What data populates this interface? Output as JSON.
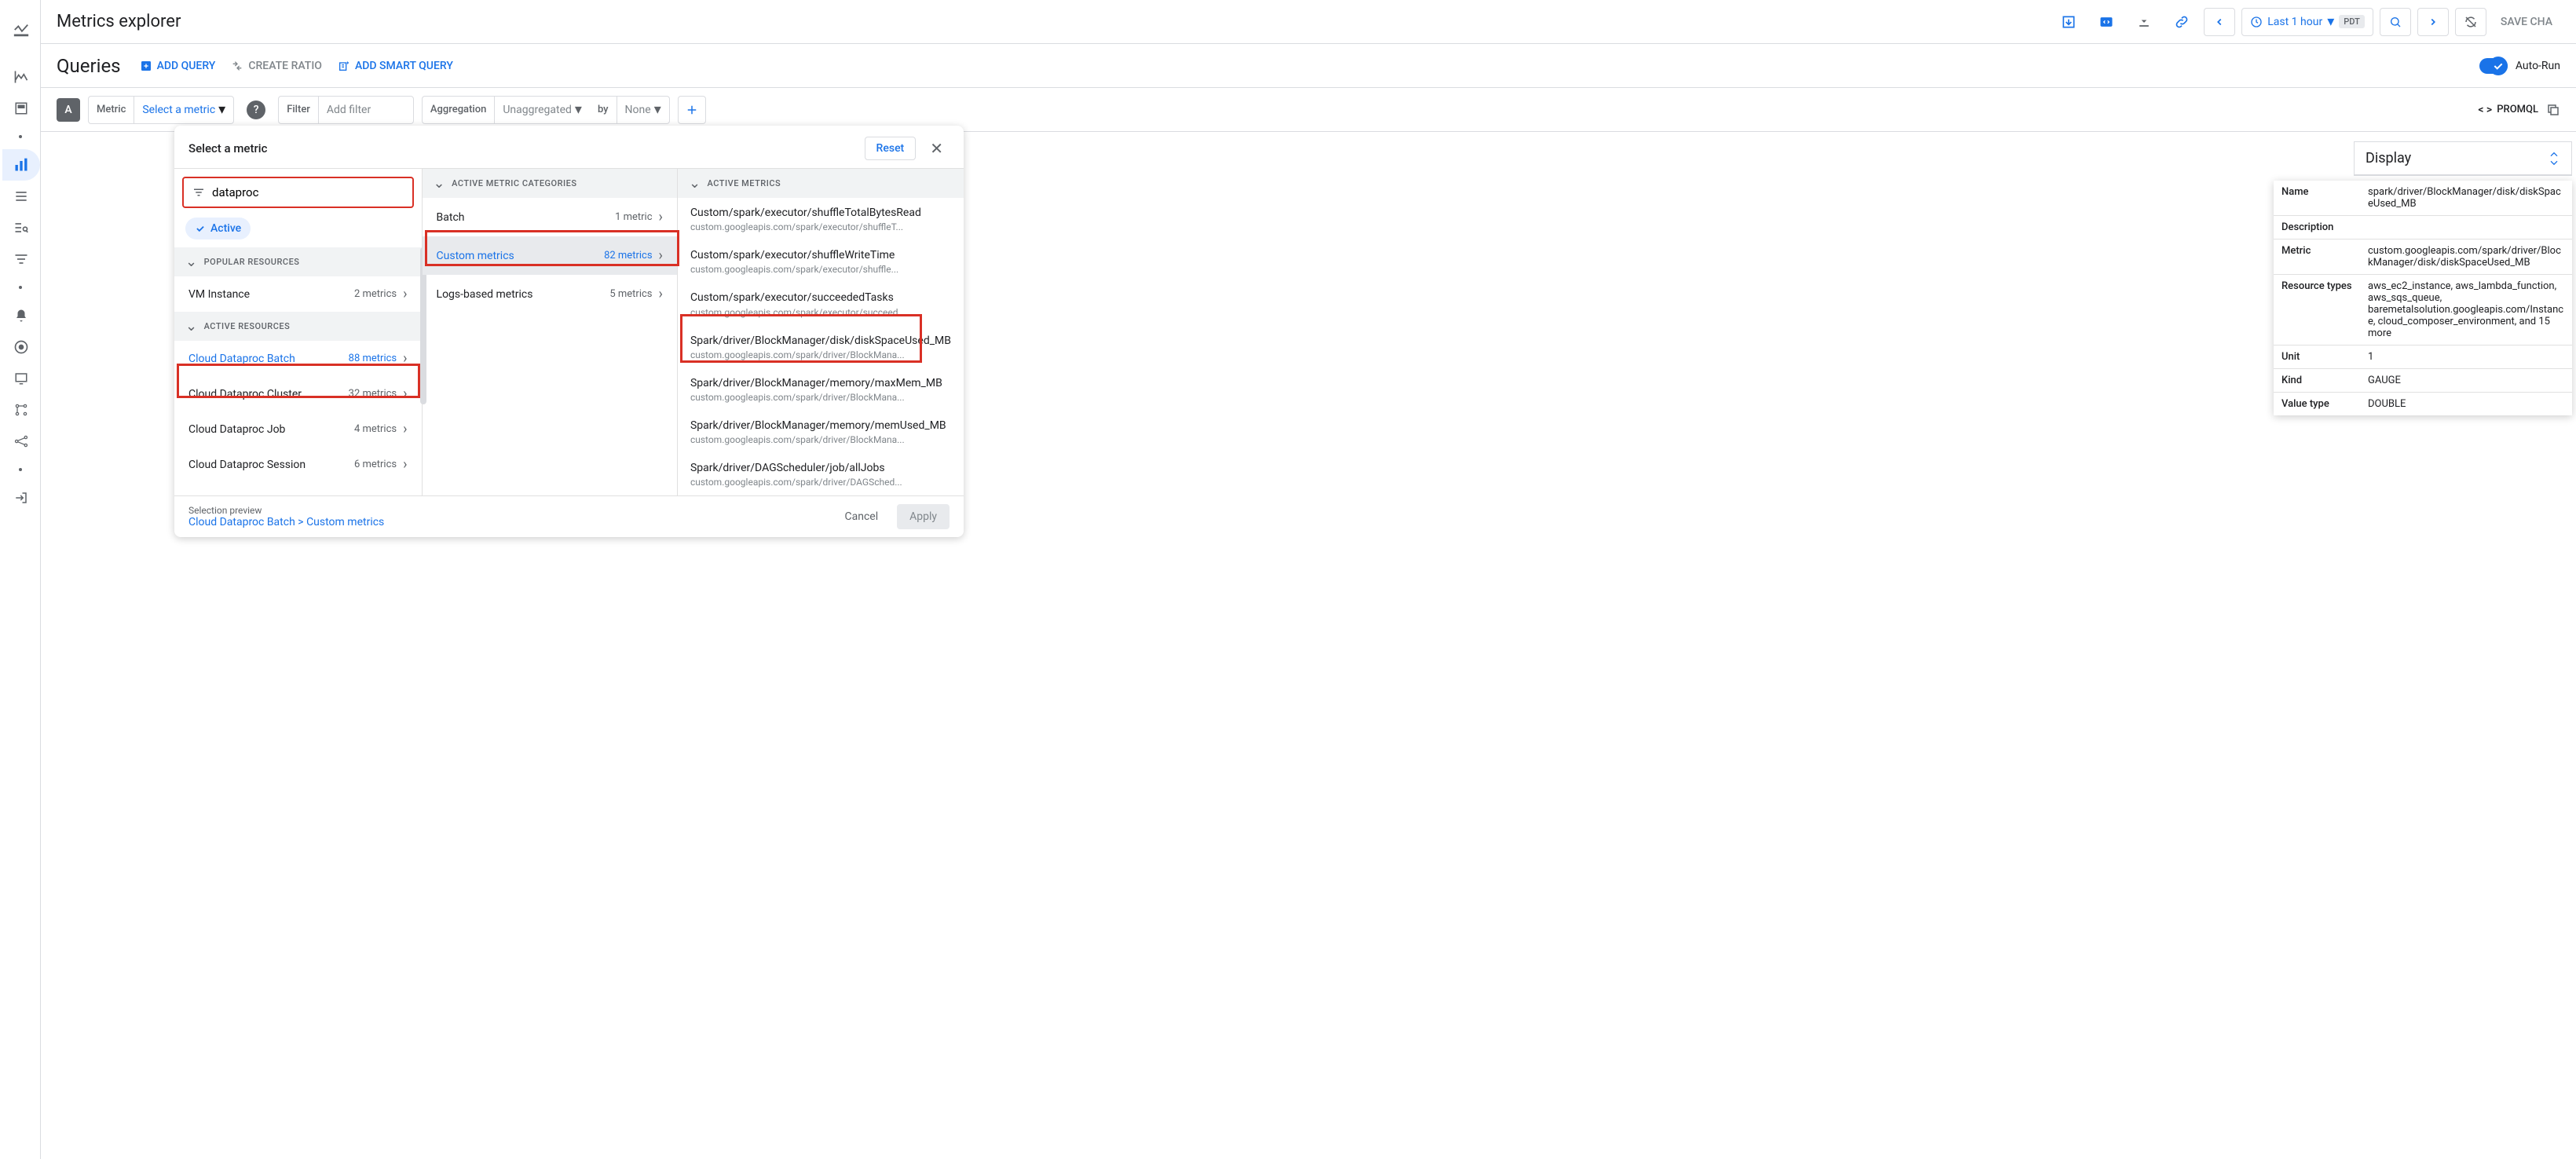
{
  "header": {
    "page_title": "Metrics explorer",
    "time_range": "Last 1 hour",
    "timezone": "PDT",
    "save_chart": "SAVE CHA"
  },
  "queries": {
    "title": "Queries",
    "add_query": "ADD QUERY",
    "create_ratio": "CREATE RATIO",
    "add_smart_query": "ADD SMART QUERY",
    "auto_run": "Auto-Run"
  },
  "builder": {
    "query_id": "A",
    "metric_label": "Metric",
    "metric_value": "Select a metric",
    "filter_label": "Filter",
    "filter_placeholder": "Add filter",
    "aggregation_label": "Aggregation",
    "aggregation_value": "Unaggregated",
    "by_label": "by",
    "by_value": "None",
    "promql": "PROMQL"
  },
  "dropdown": {
    "title": "Select a metric",
    "reset": "Reset",
    "search_value": "dataproc",
    "active_chip": "Active",
    "col1_header1": "POPULAR RESOURCES",
    "col1_header2": "ACTIVE RESOURCES",
    "resources": {
      "vm": {
        "name": "VM Instance",
        "count": "2 metrics"
      },
      "batch": {
        "name": "Cloud Dataproc Batch",
        "count": "88 metrics"
      },
      "cluster": {
        "name": "Cloud Dataproc Cluster",
        "count": "32 metrics"
      },
      "job": {
        "name": "Cloud Dataproc Job",
        "count": "4 metrics"
      },
      "session": {
        "name": "Cloud Dataproc Session",
        "count": "6 metrics"
      }
    },
    "col2_header": "ACTIVE METRIC CATEGORIES",
    "categories": {
      "batch": {
        "name": "Batch",
        "count": "1 metric"
      },
      "custom": {
        "name": "Custom metrics",
        "count": "82 metrics"
      },
      "logs": {
        "name": "Logs-based metrics",
        "count": "5 metrics"
      }
    },
    "col3_header": "ACTIVE METRICS",
    "metrics": [
      {
        "name": "Custom/spark/executor/shuffleTotalBytesRead",
        "path": "custom.googleapis.com/spark/executor/shuffleT..."
      },
      {
        "name": "Custom/spark/executor/shuffleWriteTime",
        "path": "custom.googleapis.com/spark/executor/shuffle..."
      },
      {
        "name": "Custom/spark/executor/succeededTasks",
        "path": "custom.googleapis.com/spark/executor/succeed..."
      },
      {
        "name": "Spark/driver/BlockManager/disk/diskSpaceUsed_MB",
        "path": "custom.googleapis.com/spark/driver/BlockMana..."
      },
      {
        "name": "Spark/driver/BlockManager/memory/maxMem_MB",
        "path": "custom.googleapis.com/spark/driver/BlockMana..."
      },
      {
        "name": "Spark/driver/BlockManager/memory/memUsed_MB",
        "path": "custom.googleapis.com/spark/driver/BlockMana..."
      },
      {
        "name": "Spark/driver/DAGScheduler/job/allJobs",
        "path": "custom.googleapis.com/spark/driver/DAGSched..."
      }
    ],
    "preview_label": "Selection preview",
    "preview_path": "Cloud Dataproc Batch > Custom metrics",
    "cancel": "Cancel",
    "apply": "Apply"
  },
  "display": {
    "title": "Display"
  },
  "details": {
    "name_label": "Name",
    "name_value": "spark/driver/BlockManager/disk/diskSpaceUsed_MB",
    "desc_label": "Description",
    "metric_label": "Metric",
    "metric_value": "custom.googleapis.com/spark/driver/BlockManager/disk/diskSpaceUsed_MB",
    "resource_label": "Resource types",
    "resource_value": "aws_ec2_instance, aws_lambda_function, aws_sqs_queue, baremetalsolution.googleapis.com/Instance, cloud_composer_environment, and 15 more",
    "unit_label": "Unit",
    "unit_value": "1",
    "kind_label": "Kind",
    "kind_value": "GAUGE",
    "valuetype_label": "Value type",
    "valuetype_value": "DOUBLE"
  }
}
